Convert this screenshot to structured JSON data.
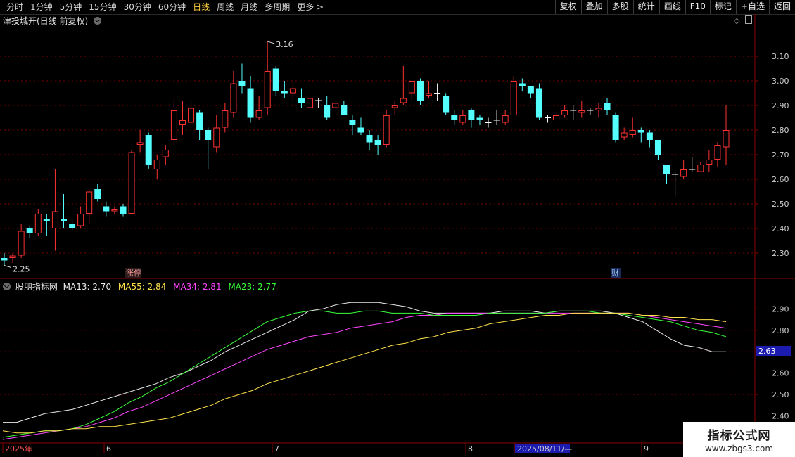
{
  "toolbar": {
    "periods": [
      "分时",
      "1分钟",
      "5分钟",
      "15分钟",
      "30分钟",
      "60分钟",
      "日线",
      "周线",
      "月线",
      "多周期",
      "更多 >"
    ],
    "active_period": "日线",
    "right_buttons": [
      "复权",
      "叠加",
      "多股",
      "统计",
      "画线",
      "F10",
      "标记",
      "+自选",
      "返回"
    ]
  },
  "chart_title": "津投城开(日线 前复权)",
  "annotations": {
    "high_label": "3.16",
    "low_label": "2.25",
    "zhangting_badge": "涨停",
    "cai_badge": "财"
  },
  "price_axis": [
    "3.10",
    "3.00",
    "2.90",
    "2.80",
    "2.70",
    "2.60",
    "2.50",
    "2.40",
    "2.30"
  ],
  "indicator": {
    "name": "股朋指标网",
    "ma13": "MA13: 2.70",
    "ma55": "MA55: 2.84",
    "ma34": "MA34: 2.81",
    "ma23": "MA23: 2.77",
    "axis": [
      "2.90",
      "2.80",
      "2.70",
      "2.60",
      "2.50",
      "2.40"
    ],
    "current_badge": "2.63"
  },
  "time_axis": [
    "2025年",
    "6",
    "7",
    "8",
    "2025/08/11/—",
    "9"
  ],
  "watermark": {
    "title": "指标公式网",
    "url": "www.zbgs3.com"
  },
  "colors": {
    "up": "#ff3232",
    "down": "#54ffff",
    "grid": "#7a0000",
    "ma13": "#e8e8e8",
    "ma55": "#ffe14a",
    "ma34": "#ff46ff",
    "ma23": "#39ff39"
  },
  "chart_data": {
    "type": "candlestick",
    "candles": [
      [
        2.28,
        2.27,
        2.3,
        2.25
      ],
      [
        2.28,
        2.29,
        2.3,
        2.26
      ],
      [
        2.29,
        2.39,
        2.42,
        2.28
      ],
      [
        2.4,
        2.38,
        2.41,
        2.36
      ],
      [
        2.38,
        2.46,
        2.48,
        2.37
      ],
      [
        2.44,
        2.43,
        2.46,
        2.37
      ],
      [
        2.4,
        2.47,
        2.64,
        2.31
      ],
      [
        2.44,
        2.43,
        2.54,
        2.4
      ],
      [
        2.42,
        2.4,
        2.44,
        2.39
      ],
      [
        2.41,
        2.46,
        2.49,
        2.4
      ],
      [
        2.46,
        2.55,
        2.56,
        2.42
      ],
      [
        2.56,
        2.52,
        2.58,
        2.51
      ],
      [
        2.49,
        2.47,
        2.51,
        2.45
      ],
      [
        2.47,
        2.48,
        2.49,
        2.46
      ],
      [
        2.49,
        2.46,
        2.5,
        2.45
      ],
      [
        2.46,
        2.71,
        2.72,
        2.46
      ],
      [
        2.74,
        2.75,
        2.8,
        2.71
      ],
      [
        2.78,
        2.66,
        2.79,
        2.64
      ],
      [
        2.64,
        2.68,
        2.7,
        2.6
      ],
      [
        2.69,
        2.72,
        2.74,
        2.66
      ],
      [
        2.76,
        2.88,
        2.93,
        2.74
      ],
      [
        2.82,
        2.84,
        2.92,
        2.78
      ],
      [
        2.83,
        2.89,
        2.92,
        2.82
      ],
      [
        2.87,
        2.8,
        2.88,
        2.76
      ],
      [
        2.8,
        2.76,
        2.81,
        2.64
      ],
      [
        2.73,
        2.81,
        2.86,
        2.71
      ],
      [
        2.81,
        2.88,
        2.91,
        2.79
      ],
      [
        2.87,
        2.99,
        3.04,
        2.85
      ],
      [
        3.0,
        2.98,
        3.07,
        2.95
      ],
      [
        2.97,
        2.85,
        3.02,
        2.83
      ],
      [
        2.85,
        2.88,
        2.94,
        2.84
      ],
      [
        2.89,
        3.04,
        3.16,
        2.86
      ],
      [
        3.05,
        2.96,
        3.06,
        2.94
      ],
      [
        2.96,
        2.95,
        3.0,
        2.93
      ],
      [
        2.95,
        2.97,
        2.99,
        2.92
      ],
      [
        2.93,
        2.91,
        2.97,
        2.89
      ],
      [
        2.89,
        2.93,
        2.95,
        2.88
      ],
      [
        2.92,
        2.92,
        2.93,
        2.89
      ],
      [
        2.9,
        2.85,
        2.94,
        2.84
      ],
      [
        2.89,
        2.91,
        2.91,
        2.9
      ],
      [
        2.9,
        2.86,
        2.92,
        2.86
      ],
      [
        2.84,
        2.82,
        2.86,
        2.78
      ],
      [
        2.81,
        2.79,
        2.85,
        2.78
      ],
      [
        2.78,
        2.75,
        2.8,
        2.72
      ],
      [
        2.76,
        2.74,
        2.78,
        2.7
      ],
      [
        2.74,
        2.86,
        2.88,
        2.73
      ],
      [
        2.89,
        2.9,
        2.92,
        2.86
      ],
      [
        2.91,
        2.93,
        3.06,
        2.9
      ],
      [
        2.95,
        3.0,
        3.0,
        2.92
      ],
      [
        3.0,
        2.92,
        3.01,
        2.9
      ],
      [
        2.94,
        2.95,
        3.0,
        2.93
      ],
      [
        2.95,
        2.95,
        2.99,
        2.92
      ],
      [
        2.94,
        2.87,
        2.95,
        2.86
      ],
      [
        2.86,
        2.84,
        2.88,
        2.82
      ],
      [
        2.83,
        2.86,
        2.88,
        2.82
      ],
      [
        2.88,
        2.84,
        2.89,
        2.81
      ],
      [
        2.85,
        2.84,
        2.86,
        2.82
      ],
      [
        2.83,
        2.83,
        2.85,
        2.81
      ],
      [
        2.84,
        2.84,
        2.88,
        2.82
      ],
      [
        2.83,
        2.86,
        2.88,
        2.82
      ],
      [
        2.86,
        3.0,
        3.02,
        2.86
      ],
      [
        2.99,
        2.98,
        3.01,
        2.96
      ],
      [
        2.98,
        2.95,
        2.98,
        2.93
      ],
      [
        2.97,
        2.85,
        2.99,
        2.84
      ],
      [
        2.85,
        2.85,
        2.86,
        2.83
      ],
      [
        2.84,
        2.86,
        2.87,
        2.84
      ],
      [
        2.86,
        2.88,
        2.9,
        2.85
      ],
      [
        2.88,
        2.88,
        2.9,
        2.84
      ],
      [
        2.87,
        2.88,
        2.92,
        2.85
      ],
      [
        2.88,
        2.88,
        2.89,
        2.86
      ],
      [
        2.88,
        2.89,
        2.91,
        2.85
      ],
      [
        2.91,
        2.88,
        2.93,
        2.86
      ],
      [
        2.86,
        2.76,
        2.87,
        2.75
      ],
      [
        2.77,
        2.79,
        2.81,
        2.76
      ],
      [
        2.78,
        2.8,
        2.85,
        2.77
      ],
      [
        2.8,
        2.79,
        2.81,
        2.75
      ],
      [
        2.79,
        2.76,
        2.8,
        2.73
      ],
      [
        2.76,
        2.7,
        2.76,
        2.68
      ],
      [
        2.66,
        2.62,
        2.66,
        2.58
      ],
      [
        2.62,
        2.62,
        2.63,
        2.53
      ],
      [
        2.61,
        2.64,
        2.68,
        2.6
      ],
      [
        2.64,
        2.64,
        2.69,
        2.63
      ],
      [
        2.63,
        2.66,
        2.67,
        2.63
      ],
      [
        2.66,
        2.68,
        2.72,
        2.63
      ],
      [
        2.68,
        2.74,
        2.75,
        2.65
      ],
      [
        2.73,
        2.8,
        2.9,
        2.66
      ]
    ],
    "ma": {
      "MA13": [
        2.37,
        2.37,
        2.39,
        2.41,
        2.42,
        2.43,
        2.45,
        2.47,
        2.49,
        2.51,
        2.53,
        2.55,
        2.58,
        2.6,
        2.63,
        2.66,
        2.7,
        2.73,
        2.76,
        2.79,
        2.82,
        2.85,
        2.89,
        2.9,
        2.92,
        2.93,
        2.93,
        2.93,
        2.92,
        2.91,
        2.89,
        2.88,
        2.88,
        2.88,
        2.88,
        2.88,
        2.89,
        2.89,
        2.89,
        2.88,
        2.89,
        2.89,
        2.89,
        2.89,
        2.88,
        2.86,
        2.84,
        2.8,
        2.76,
        2.73,
        2.72,
        2.7,
        2.7
      ],
      "MA34": [
        2.29,
        2.3,
        2.31,
        2.32,
        2.33,
        2.34,
        2.35,
        2.37,
        2.39,
        2.42,
        2.44,
        2.47,
        2.5,
        2.53,
        2.56,
        2.59,
        2.62,
        2.65,
        2.68,
        2.71,
        2.73,
        2.75,
        2.77,
        2.78,
        2.79,
        2.81,
        2.82,
        2.83,
        2.84,
        2.86,
        2.87,
        2.87,
        2.88,
        2.88,
        2.88,
        2.88,
        2.88,
        2.88,
        2.88,
        2.88,
        2.88,
        2.88,
        2.88,
        2.88,
        2.88,
        2.88,
        2.87,
        2.86,
        2.85,
        2.84,
        2.83,
        2.82,
        2.81
      ],
      "MA23": [
        2.3,
        2.31,
        2.32,
        2.33,
        2.33,
        2.34,
        2.36,
        2.39,
        2.42,
        2.46,
        2.49,
        2.53,
        2.56,
        2.6,
        2.64,
        2.68,
        2.72,
        2.76,
        2.8,
        2.84,
        2.86,
        2.88,
        2.89,
        2.89,
        2.88,
        2.88,
        2.89,
        2.89,
        2.88,
        2.88,
        2.88,
        2.87,
        2.87,
        2.87,
        2.87,
        2.88,
        2.88,
        2.88,
        2.88,
        2.88,
        2.89,
        2.89,
        2.89,
        2.88,
        2.88,
        2.87,
        2.86,
        2.85,
        2.84,
        2.82,
        2.8,
        2.79,
        2.77
      ],
      "MA55": [
        2.33,
        2.32,
        2.32,
        2.33,
        2.33,
        2.34,
        2.34,
        2.35,
        2.35,
        2.36,
        2.37,
        2.38,
        2.39,
        2.41,
        2.43,
        2.45,
        2.48,
        2.5,
        2.52,
        2.55,
        2.57,
        2.59,
        2.61,
        2.63,
        2.65,
        2.67,
        2.69,
        2.71,
        2.73,
        2.74,
        2.76,
        2.77,
        2.79,
        2.8,
        2.81,
        2.83,
        2.84,
        2.85,
        2.86,
        2.87,
        2.87,
        2.88,
        2.88,
        2.88,
        2.88,
        2.88,
        2.87,
        2.87,
        2.86,
        2.86,
        2.85,
        2.85,
        2.84
      ]
    },
    "price_ylim": [
      2.2,
      3.22
    ],
    "indicator_ylim": [
      2.28,
      2.98
    ]
  }
}
